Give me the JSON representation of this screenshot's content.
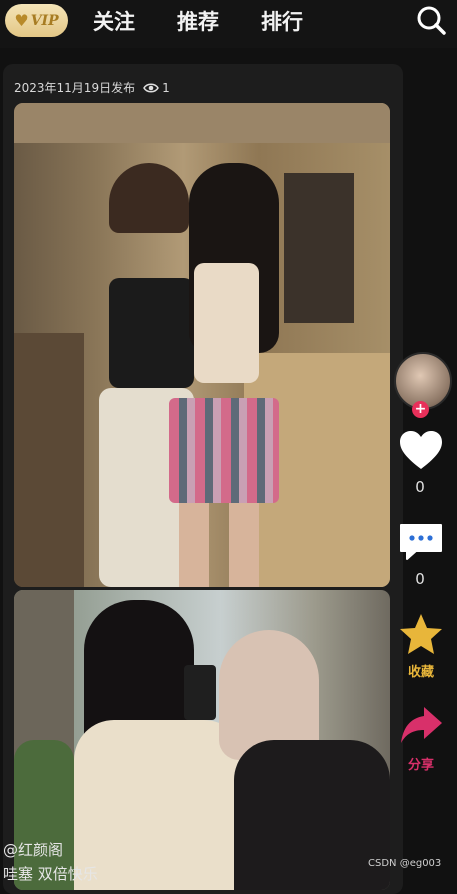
{
  "nav": {
    "vip": "VIP",
    "tabs": [
      "关注",
      "推荐",
      "排行"
    ]
  },
  "post": {
    "date": "2023年11月19日发布",
    "views": "1"
  },
  "rail": {
    "like_count": "0",
    "comment_count": "0",
    "collect_label": "收藏",
    "share_label": "分享"
  },
  "watermark": {
    "channel": "@红颜阁",
    "caption": "哇塞 双倍快乐",
    "csdn": "CSDN @eg003"
  },
  "colors": {
    "collect": "#e8b63a",
    "share": "#d8306a"
  }
}
